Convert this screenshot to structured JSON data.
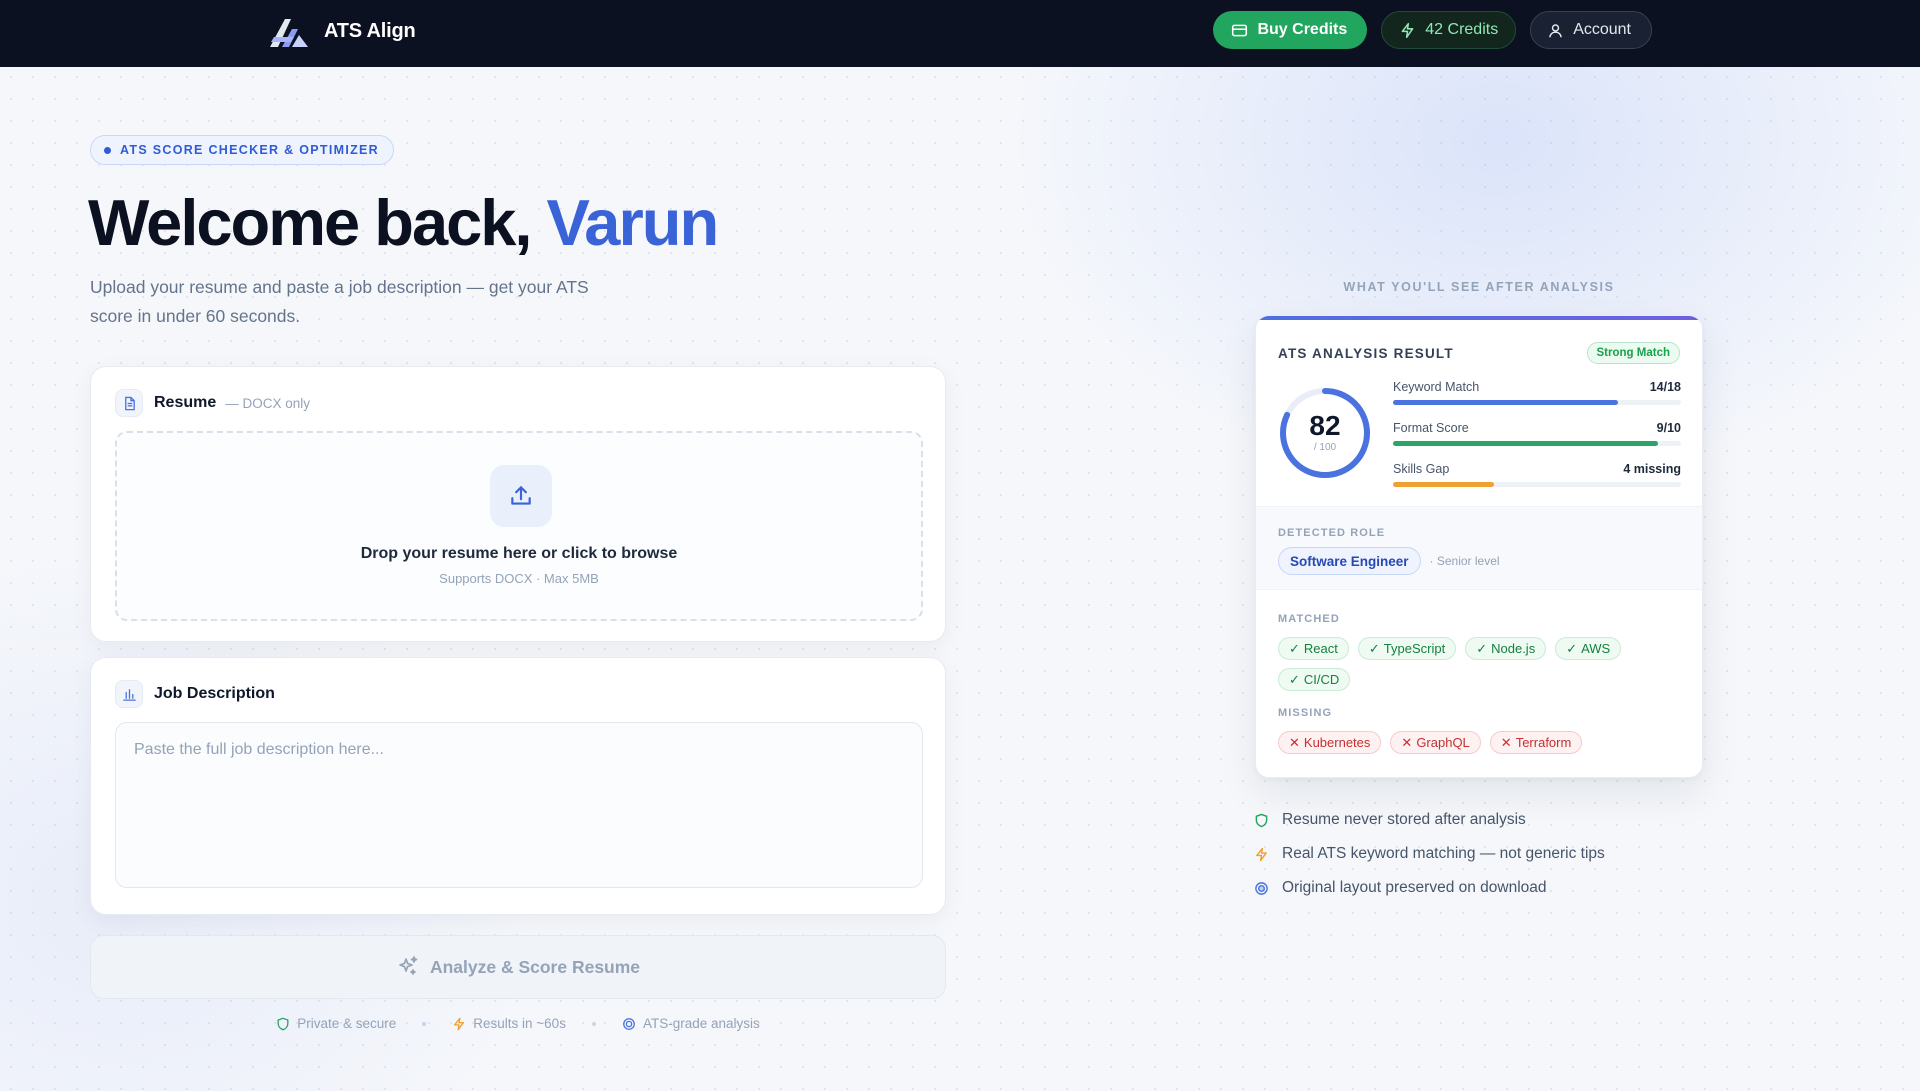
{
  "app": {
    "brand_name": "ATS Align",
    "accent": "#3a63d8",
    "success": "#22a55e"
  },
  "nav": {
    "buy_label": "Buy Credits",
    "credits_label": "42 Credits",
    "account_label": "Account"
  },
  "hero": {
    "eyebrow": "ATS SCORE CHECKER & OPTIMIZER",
    "title_prefix": "Welcome back,",
    "user_name": "Varun",
    "subtitle": "Upload your resume and paste a job description — get your ATS score in under 60 seconds."
  },
  "resume": {
    "title": "Resume",
    "note": "— DOCX only",
    "drop_title": "Drop your resume here or click to browse",
    "drop_sub": "Supports DOCX · Max 5MB"
  },
  "job": {
    "title": "Job Description",
    "placeholder": "Paste the full job description here...",
    "value": ""
  },
  "analyze": {
    "label": "Analyze & Score Resume"
  },
  "trust": [
    {
      "label": "Private & secure",
      "icon": "shield-icon"
    },
    {
      "label": "Results in ~60s",
      "icon": "bolt-icon"
    },
    {
      "label": "ATS-grade analysis",
      "icon": "target-icon"
    }
  ],
  "preview": {
    "label": "WHAT YOU'LL SEE AFTER ANALYSIS",
    "title": "ATS ANALYSIS RESULT",
    "badge": "Strong Match",
    "score": "82",
    "score_value": 82,
    "score_max": "/ 100",
    "metrics": [
      {
        "label": "Keyword Match",
        "value": "14/18",
        "fill": 0.78,
        "color": "#4a73e0"
      },
      {
        "label": "Format Score",
        "value": "9/10",
        "fill": 0.92,
        "color": "#2aa566"
      },
      {
        "label": "Skills Gap",
        "value": "4 missing",
        "fill": 0.35,
        "color": "#f0a030"
      }
    ],
    "role_section_label": "DETECTED ROLE",
    "role": "Software Engineer",
    "role_level": "· Senior level",
    "matched_label": "MATCHED",
    "matched": [
      "React",
      "TypeScript",
      "Node.js",
      "AWS",
      "CI/CD"
    ],
    "missing_label": "MISSING",
    "missing": [
      "Kubernetes",
      "GraphQL",
      "Terraform"
    ]
  },
  "features": [
    {
      "label": "Resume never stored after analysis",
      "icon": "shield-icon",
      "color": "#22a55e"
    },
    {
      "label": "Real ATS keyword matching — not generic tips",
      "icon": "bolt-icon",
      "color": "#f0a030"
    },
    {
      "label": "Original layout preserved on download",
      "icon": "target-icon",
      "color": "#4a73e0"
    }
  ]
}
